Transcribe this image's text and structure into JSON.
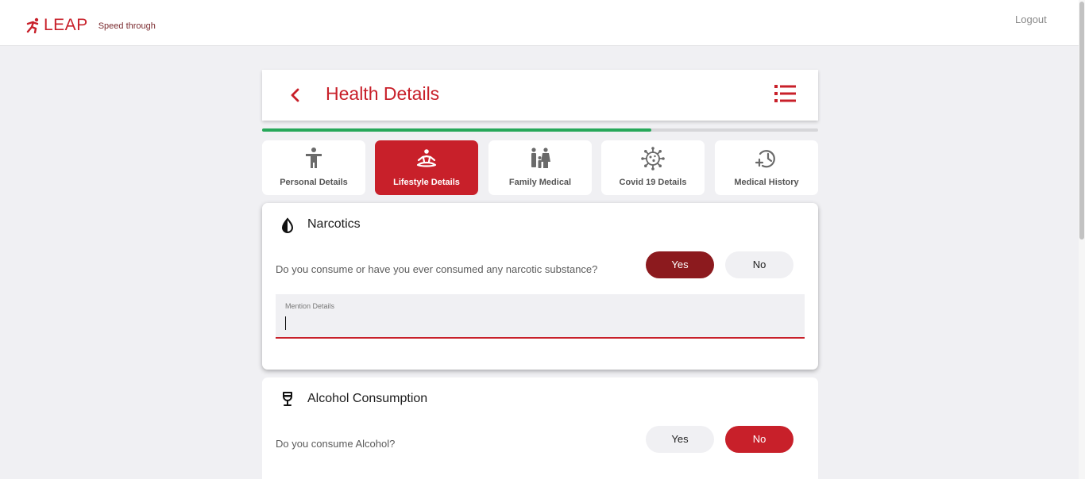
{
  "brand": {
    "name": "LEAP",
    "tagline": "Speed through",
    "color": "#c8202a"
  },
  "topbar": {
    "logout_label": "Logout"
  },
  "header": {
    "title": "Health Details",
    "back_icon": "chevron-left-icon",
    "menu_icon": "list-menu-icon"
  },
  "progress": {
    "fraction": 0.7,
    "color": "#27a85a"
  },
  "tabs": [
    {
      "label": "Personal Details",
      "icon": "person-icon",
      "active": false
    },
    {
      "label": "Lifestyle Details",
      "icon": "meditation-icon",
      "active": true
    },
    {
      "label": "Family Medical",
      "icon": "family-icon",
      "active": false
    },
    {
      "label": "Covid 19 Details",
      "icon": "virus-icon",
      "active": false
    },
    {
      "label": "Medical History",
      "icon": "history-icon",
      "active": false
    }
  ],
  "narcotics": {
    "title": "Narcotics",
    "icon": "half-drop-icon",
    "question": "Do you consume or have you ever consumed any narcotic substance?",
    "yes_label": "Yes",
    "no_label": "No",
    "selected": "Yes",
    "details_label": "Mention Details",
    "details_value": ""
  },
  "alcohol": {
    "title": "Alcohol Consumption",
    "icon": "wine-glass-icon",
    "question": "Do you consume Alcohol?",
    "yes_label": "Yes",
    "no_label": "No",
    "selected": "No"
  }
}
